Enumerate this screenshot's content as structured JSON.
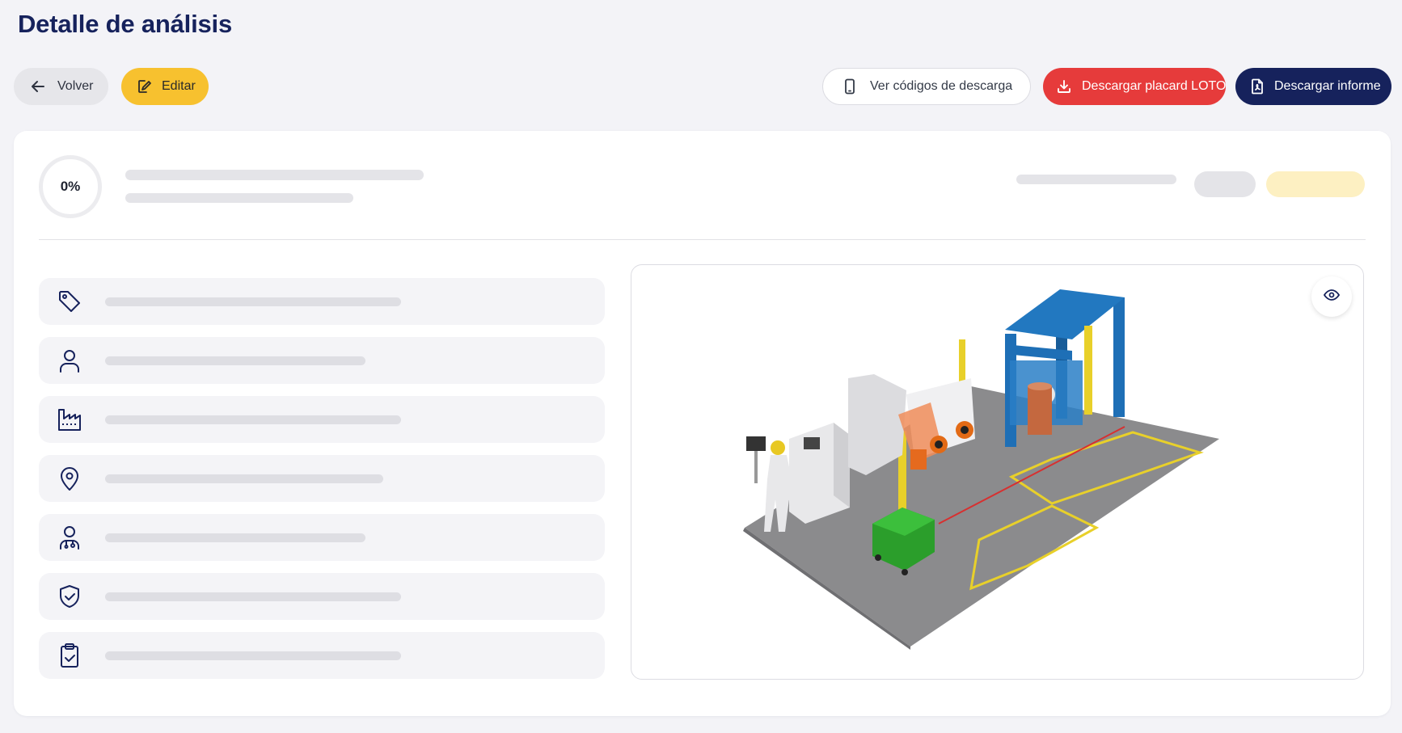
{
  "page": {
    "title": "Detalle de análisis"
  },
  "toolbar": {
    "back_label": "Volver",
    "edit_label": "Editar",
    "codes_label": "Ver códigos de descarga",
    "loto_label": "Descargar placard LOTO",
    "report_label": "Descargar informe"
  },
  "summary": {
    "progress": "0%"
  },
  "info_rows": [
    {
      "icon": "tag-icon"
    },
    {
      "icon": "user-icon"
    },
    {
      "icon": "factory-icon"
    },
    {
      "icon": "location-pin-icon"
    },
    {
      "icon": "worker-icon"
    },
    {
      "icon": "shield-check-icon"
    },
    {
      "icon": "clipboard-check-icon"
    }
  ],
  "preview": {
    "icon": "eye-icon"
  },
  "colors": {
    "brand_navy": "#16225c",
    "accent_yellow": "#f7c12f",
    "danger_red": "#e63b3b",
    "background": "#f3f3f7"
  }
}
